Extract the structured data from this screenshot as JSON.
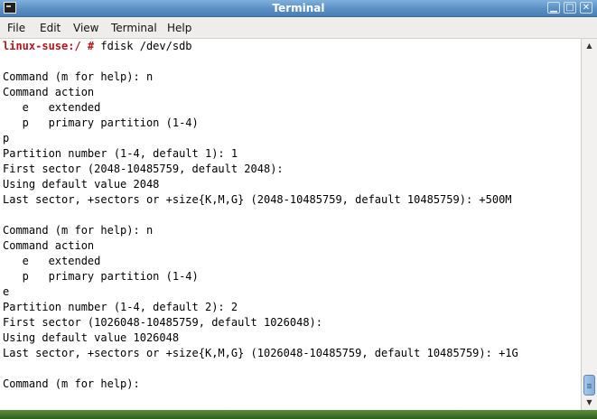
{
  "window": {
    "title": "Terminal",
    "icon": "terminal-icon",
    "controls": [
      "minimize-icon",
      "maximize-icon",
      "close-icon"
    ],
    "control_glyphs": [
      "▁",
      "□",
      "✕"
    ]
  },
  "menu": [
    "File",
    "Edit",
    "View",
    "Terminal",
    "Help"
  ],
  "terminal": {
    "prompt": "linux-suse:/ #",
    "command": " fdisk /dev/sdb",
    "lines": [
      "",
      "Command (m for help): n",
      "Command action",
      "   e   extended",
      "   p   primary partition (1-4)",
      "p",
      "Partition number (1-4, default 1): 1",
      "First sector (2048-10485759, default 2048):",
      "Using default value 2048",
      "Last sector, +sectors or +size{K,M,G} (2048-10485759, default 10485759): +500M",
      "",
      "Command (m for help): n",
      "Command action",
      "   e   extended",
      "   p   primary partition (1-4)",
      "e",
      "Partition number (1-4, default 2): 2",
      "First sector (1026048-10485759, default 1026048):",
      "Using default value 1026048",
      "Last sector, +sectors or +size{K,M,G} (1026048-10485759, default 10485759): +1G",
      "",
      "Command (m for help):"
    ]
  },
  "scrollbar": {
    "position": 1.0,
    "visible_fraction": 0.06
  },
  "colors": {
    "prompt": "#b4161b",
    "titlebar": "#5b8fc3",
    "taskbar": "#3f7a2a"
  }
}
